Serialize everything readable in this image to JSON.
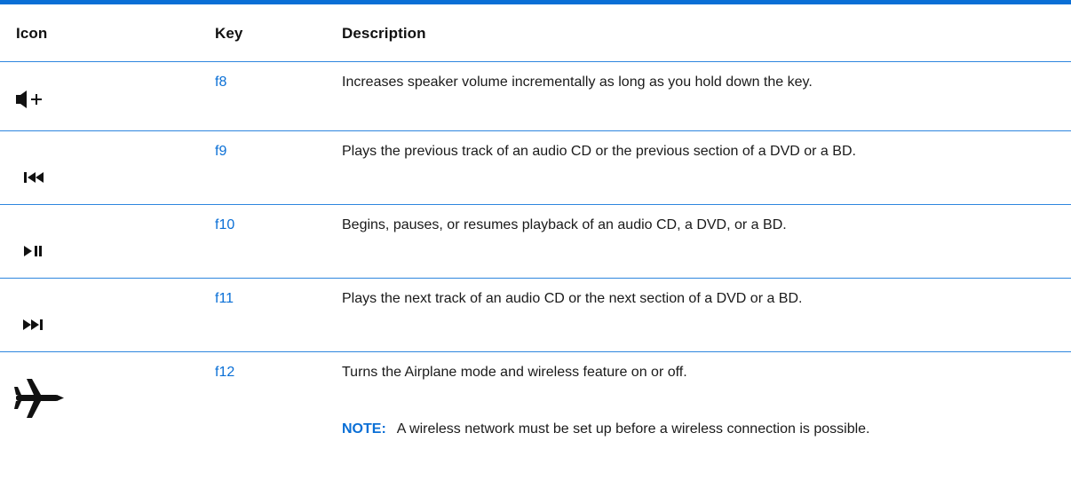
{
  "header": {
    "icon": "Icon",
    "key": "Key",
    "description": "Description"
  },
  "rows": [
    {
      "icon": "volume-up-icon",
      "key": "f8",
      "description": "Increases speaker volume incrementally as long as you hold down the key."
    },
    {
      "icon": "previous-track-icon",
      "key": "f9",
      "description": "Plays the previous track of an audio CD or the previous section of a DVD or a BD."
    },
    {
      "icon": "play-pause-icon",
      "key": "f10",
      "description": "Begins, pauses, or resumes playback of an audio CD, a DVD, or a BD."
    },
    {
      "icon": "next-track-icon",
      "key": "f11",
      "description": "Plays the next track of an audio CD or the next section of a DVD or a BD."
    },
    {
      "icon": "airplane-icon",
      "key": "f12",
      "description": "Turns the Airplane mode and wireless feature on or off.",
      "note_label": "NOTE:",
      "note_text": "A wireless network must be set up before a wireless connection is possible."
    }
  ],
  "colors": {
    "accent": "#0a6fd6",
    "rule": "#2e86de",
    "text": "#1a1a1a"
  }
}
